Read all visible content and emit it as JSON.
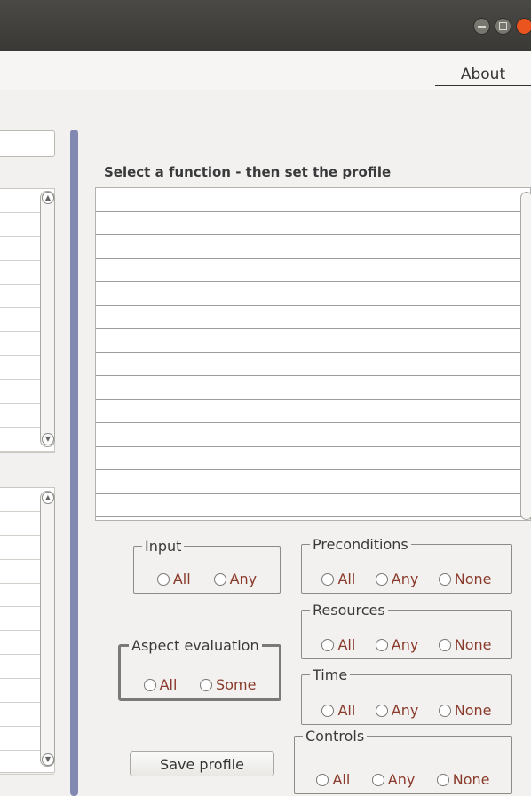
{
  "window": {
    "controls": [
      "minimize-icon",
      "maximize-icon",
      "close-icon"
    ],
    "accent_close": "#e9541f"
  },
  "menu": {
    "about": "About"
  },
  "function_panel": {
    "title": "Select a function - then set the profile",
    "rows": 14
  },
  "left_lists": {
    "upper_rows": 11,
    "lower_rows": 12
  },
  "groups": {
    "input": {
      "title": "Input",
      "options": [
        "All",
        "Any"
      ]
    },
    "preconditions": {
      "title": "Preconditions",
      "options": [
        "All",
        "Any",
        "None"
      ]
    },
    "resources": {
      "title": "Resources",
      "options": [
        "All",
        "Any",
        "None"
      ]
    },
    "aspect": {
      "title": "Aspect evaluation",
      "options": [
        "All",
        "Some"
      ]
    },
    "time": {
      "title": "Time",
      "options": [
        "All",
        "Any",
        "None"
      ]
    },
    "controls": {
      "title": "Controls",
      "options": [
        "All",
        "Any",
        "None"
      ]
    }
  },
  "save_button": "Save profile",
  "colors": {
    "title_bar": "#3f3e3a",
    "divider": "#8189b3",
    "option_text": "#8a3a2a"
  }
}
